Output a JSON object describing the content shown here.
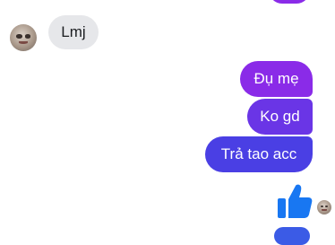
{
  "colors": {
    "incoming_bubble": "#e6e7ea",
    "outgoing_top": "#8a2be8",
    "outgoing_mid": "#6a35e6",
    "outgoing_bottom": "#4a3fe4",
    "like_icon": "#1877f2"
  },
  "messages": [
    {
      "direction": "incoming",
      "text": "Lmj"
    },
    {
      "direction": "outgoing",
      "text": "Đụ mẹ"
    },
    {
      "direction": "outgoing",
      "text": "Ko gd"
    },
    {
      "direction": "outgoing",
      "text": "Trả tao acc"
    }
  ],
  "like": {
    "icon": "thumbs-up-icon"
  }
}
